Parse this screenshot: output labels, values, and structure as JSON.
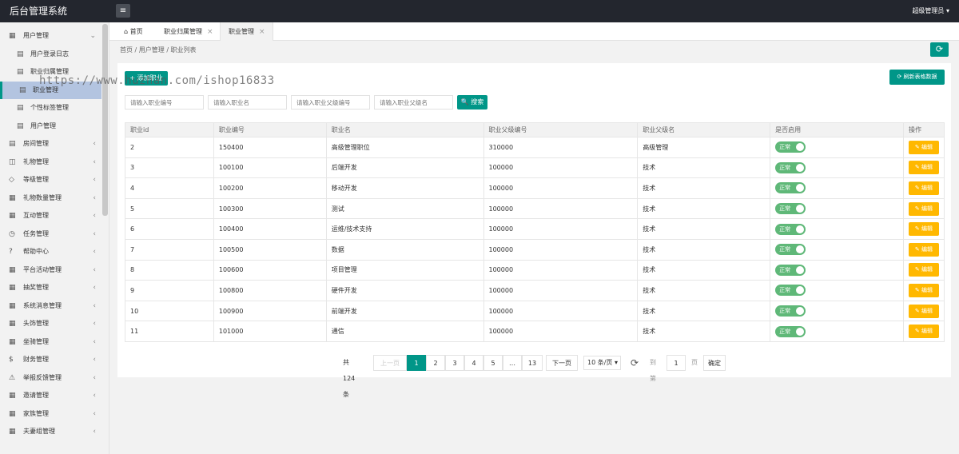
{
  "app": {
    "title": "后台管理系统",
    "user": "超级管理员 ▾",
    "menu_icon": "≡"
  },
  "sidebar": {
    "items": [
      {
        "icon": "▦",
        "label": "用户管理",
        "arrow": "⌄"
      },
      {
        "icon": "▤",
        "label": "用户登录日志",
        "arrow": ""
      },
      {
        "icon": "▤",
        "label": "职业归属管理",
        "arrow": ""
      },
      {
        "icon": "▤",
        "label": "职业管理",
        "arrow": ""
      },
      {
        "icon": "▤",
        "label": "个性标签管理",
        "arrow": ""
      },
      {
        "icon": "▤",
        "label": "用户管理",
        "arrow": ""
      },
      {
        "icon": "▤",
        "label": "房间管理",
        "arrow": "‹"
      },
      {
        "icon": "◫",
        "label": "礼物管理",
        "arrow": "‹"
      },
      {
        "icon": "◇",
        "label": "等级管理",
        "arrow": "‹"
      },
      {
        "icon": "▦",
        "label": "礼物数量管理",
        "arrow": "‹"
      },
      {
        "icon": "▦",
        "label": "互动管理",
        "arrow": "‹"
      },
      {
        "icon": "◷",
        "label": "任务管理",
        "arrow": "‹"
      },
      {
        "icon": "?",
        "label": "帮助中心",
        "arrow": "‹"
      },
      {
        "icon": "▦",
        "label": "平台活动管理",
        "arrow": "‹"
      },
      {
        "icon": "▦",
        "label": "抽奖管理",
        "arrow": "‹"
      },
      {
        "icon": "▦",
        "label": "系统消息管理",
        "arrow": "‹"
      },
      {
        "icon": "▦",
        "label": "头饰管理",
        "arrow": "‹"
      },
      {
        "icon": "▦",
        "label": "坐骑管理",
        "arrow": "‹"
      },
      {
        "icon": "$",
        "label": "财务管理",
        "arrow": "‹"
      },
      {
        "icon": "⚠",
        "label": "举报反馈管理",
        "arrow": "‹"
      },
      {
        "icon": "▦",
        "label": "邀请管理",
        "arrow": "‹"
      },
      {
        "icon": "▦",
        "label": "家族管理",
        "arrow": "‹"
      },
      {
        "icon": "▦",
        "label": "夫妻组管理",
        "arrow": "‹"
      }
    ]
  },
  "tabs": [
    {
      "label": "⌂ 首页",
      "close": ""
    },
    {
      "label": "职业归属管理",
      "close": "×"
    },
    {
      "label": "职业管理",
      "close": "×"
    }
  ],
  "breadcrumb": "首页  /  用户管理  /  职业列表",
  "refresh_icon": "⟳",
  "watermark": "https://www.huzhan.com/ishop16833",
  "toolbar": {
    "add_label": "+ 添加职业",
    "refresh_data_label": "⟳ 刷新表格数据"
  },
  "search": {
    "placeholders": [
      "请输入职业编号",
      "请输入职业名",
      "请输入职业父级编号",
      "请输入职业父级名"
    ],
    "button_label": "🔍 搜索"
  },
  "table": {
    "columns": [
      "职业id",
      "职业编号",
      "职业名",
      "职业父级编号",
      "职业父级名",
      "是否启用",
      "操作"
    ],
    "status_label": "正常",
    "edit_label": "✎ 编辑",
    "rows": [
      [
        "2",
        "150400",
        "高级管理职位",
        "310000",
        "高级管理"
      ],
      [
        "3",
        "100100",
        "后端开发",
        "100000",
        "技术"
      ],
      [
        "4",
        "100200",
        "移动开发",
        "100000",
        "技术"
      ],
      [
        "5",
        "100300",
        "测试",
        "100000",
        "技术"
      ],
      [
        "6",
        "100400",
        "运维/技术支持",
        "100000",
        "技术"
      ],
      [
        "7",
        "100500",
        "数据",
        "100000",
        "技术"
      ],
      [
        "8",
        "100600",
        "项目管理",
        "100000",
        "技术"
      ],
      [
        "9",
        "100800",
        "硬件开发",
        "100000",
        "技术"
      ],
      [
        "10",
        "100900",
        "前端开发",
        "100000",
        "技术"
      ],
      [
        "11",
        "101000",
        "通信",
        "100000",
        "技术"
      ]
    ]
  },
  "pagination": {
    "total": "共 124 条",
    "prev": "上一页",
    "pages": [
      "1",
      "2",
      "3",
      "4",
      "5",
      "…",
      "13"
    ],
    "current": "1",
    "next": "下一页",
    "page_size": "10 条/页 ▾",
    "refresh": "⟳",
    "goto_label": "到第",
    "goto_value": "1",
    "page_unit": "页",
    "confirm": "确定"
  }
}
